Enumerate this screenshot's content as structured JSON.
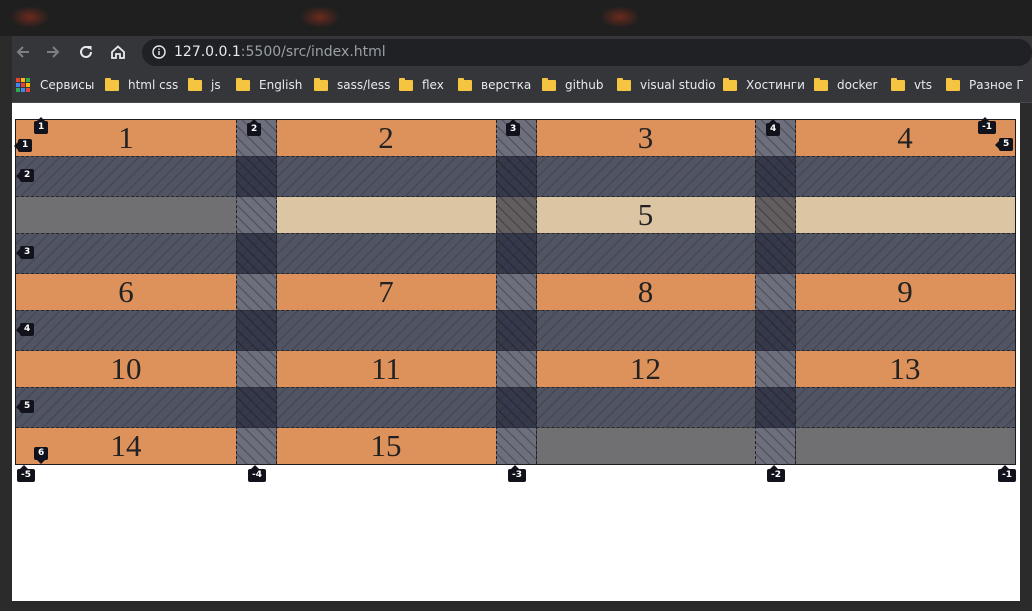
{
  "browser": {
    "url_host": "127.0.0.1",
    "url_rest": ":5500/src/index.html",
    "bookmarks": [
      {
        "label": "Сервисы",
        "icon": "apps-grid-icon"
      },
      {
        "label": "html css",
        "icon": "folder-icon"
      },
      {
        "label": "js",
        "icon": "folder-icon"
      },
      {
        "label": "English",
        "icon": "folder-icon"
      },
      {
        "label": "sass/less",
        "icon": "folder-icon"
      },
      {
        "label": "flex",
        "icon": "folder-icon"
      },
      {
        "label": "верстка",
        "icon": "folder-icon"
      },
      {
        "label": "github",
        "icon": "folder-icon"
      },
      {
        "label": "visual studio",
        "icon": "folder-icon"
      },
      {
        "label": "Хостинги",
        "icon": "folder-icon"
      },
      {
        "label": "docker",
        "icon": "folder-icon"
      },
      {
        "label": "vts",
        "icon": "folder-icon"
      },
      {
        "label": "Разное Г",
        "icon": "folder-icon"
      }
    ]
  },
  "grid": {
    "items": [
      "1",
      "2",
      "3",
      "4",
      "5",
      "6",
      "7",
      "8",
      "9",
      "10",
      "11",
      "12",
      "13",
      "14",
      "15"
    ],
    "column_line_labels_top": [
      "1",
      "2",
      "3",
      "4",
      "-1",
      "5"
    ],
    "column_line_labels_bottom": [
      "-5",
      "-4",
      "-3",
      "-2",
      "-1"
    ],
    "row_line_labels": [
      "1",
      "2",
      "3",
      "4",
      "5",
      "6"
    ],
    "colors": {
      "item": "#dd925c",
      "wide_item": "#dcc5a2",
      "empty_area": "#707072",
      "gap": "#4c4f5e"
    }
  }
}
